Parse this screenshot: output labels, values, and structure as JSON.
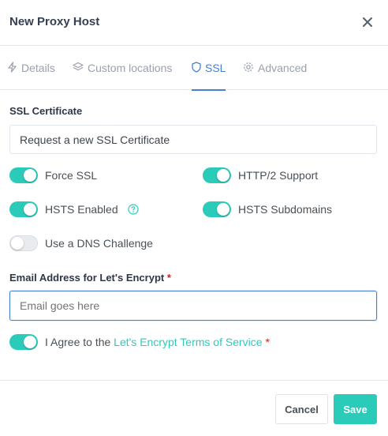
{
  "header": {
    "title": "New Proxy Host",
    "close_icon": "close-icon"
  },
  "tabs": [
    {
      "label": "Details",
      "icon": "bolt-icon",
      "active": false
    },
    {
      "label": "Custom locations",
      "icon": "layers-icon",
      "active": false
    },
    {
      "label": "SSL",
      "icon": "shield-icon",
      "active": true
    },
    {
      "label": "Advanced",
      "icon": "gear-icon",
      "active": false
    }
  ],
  "ssl": {
    "certificate_label": "SSL Certificate",
    "certificate_value": "Request a new SSL Certificate",
    "toggles": {
      "force_ssl": {
        "label": "Force SSL",
        "on": true
      },
      "http2": {
        "label": "HTTP/2 Support",
        "on": true
      },
      "hsts": {
        "label": "HSTS Enabled",
        "on": true
      },
      "hsts_subdomains": {
        "label": "HSTS Subdomains",
        "on": true
      },
      "dns_challenge": {
        "label": "Use a DNS Challenge",
        "on": false
      }
    },
    "email_label": "Email Address for Let's Encrypt",
    "required_mark": "*",
    "email_placeholder": "Email goes here",
    "agree_prefix": "I Agree to the ",
    "agree_link": "Let's Encrypt Terms of Service",
    "agree_on": true
  },
  "footer": {
    "cancel_label": "Cancel",
    "save_label": "Save"
  },
  "colors": {
    "accent": "#2bcbba",
    "primary": "#467fcf",
    "required": "#cd201f"
  }
}
